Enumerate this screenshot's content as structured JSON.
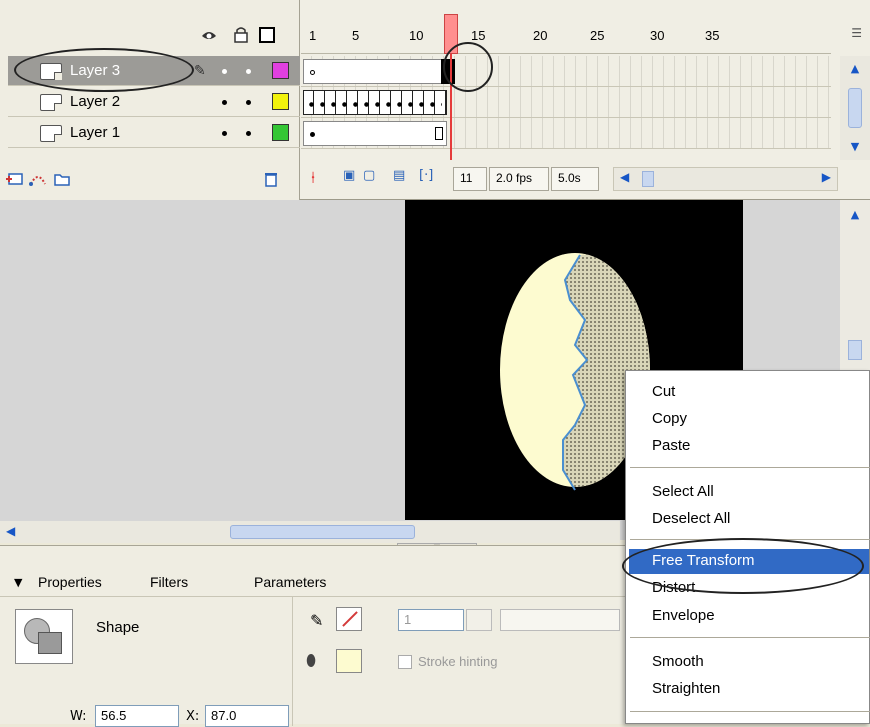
{
  "timeline": {
    "layers": [
      {
        "name": "Layer 3",
        "selected": true,
        "color": "#e040e0"
      },
      {
        "name": "Layer 2",
        "selected": false,
        "color": "#f2f20c"
      },
      {
        "name": "Layer 1",
        "selected": false,
        "color": "#34c634"
      }
    ],
    "ruler_ticks": [
      "1",
      "5",
      "10",
      "15",
      "20",
      "25",
      "30",
      "35"
    ],
    "current_frame": "11",
    "fps": "2.0 fps",
    "time": "5.0s"
  },
  "properties": {
    "tabs": [
      "Properties",
      "Filters",
      "Parameters"
    ],
    "object_type": "Shape",
    "stroke_width": "1",
    "stroke_hinting_label": "Stroke hinting",
    "w_label": "W:",
    "w_value": "56.5",
    "x_label": "X:",
    "x_value": "87.0"
  },
  "context_menu": {
    "group1": [
      "Cut",
      "Copy",
      "Paste"
    ],
    "group2": [
      "Select All",
      "Deselect All"
    ],
    "group3": [
      "Free Transform",
      "Distort",
      "Envelope"
    ],
    "group4": [
      "Smooth",
      "Straighten"
    ],
    "highlighted": "Free Transform"
  },
  "colors": {
    "stage_bg": "#000000",
    "egg_fill": "#fdfbd0",
    "stroke": "#4a8fd0",
    "menu_highlight": "#316ac5"
  }
}
